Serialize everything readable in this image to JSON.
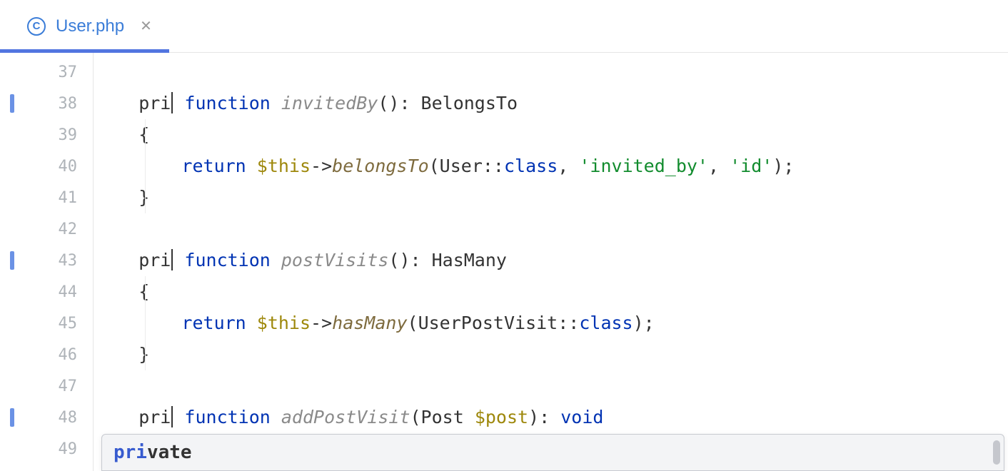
{
  "tab": {
    "name": "User.php",
    "icon_letter": "C"
  },
  "gutter": {
    "lines": [
      {
        "num": "37",
        "modified": false
      },
      {
        "num": "38",
        "modified": true
      },
      {
        "num": "39",
        "modified": false
      },
      {
        "num": "40",
        "modified": false
      },
      {
        "num": "41",
        "modified": false
      },
      {
        "num": "42",
        "modified": false
      },
      {
        "num": "43",
        "modified": true
      },
      {
        "num": "44",
        "modified": false
      },
      {
        "num": "45",
        "modified": false
      },
      {
        "num": "46",
        "modified": false
      },
      {
        "num": "47",
        "modified": false
      },
      {
        "num": "48",
        "modified": true
      },
      {
        "num": "49",
        "modified": false
      }
    ]
  },
  "code": {
    "line38_pre": "    pri",
    "line38_kw": " function ",
    "line38_fn": "invitedBy",
    "line38_after": "(): BelongsTo",
    "line39": "    {",
    "line40_indent": "        ",
    "line40_return": "return ",
    "line40_this": "$this",
    "line40_arrow": "->",
    "line40_method": "belongsTo",
    "line40_open": "(User::",
    "line40_class": "class",
    "line40_comma": ", ",
    "line40_str1": "'invited_by'",
    "line40_comma2": ", ",
    "line40_str2": "'id'",
    "line40_close": ");",
    "line41": "    }",
    "line43_pre": "    pri",
    "line43_kw": " function ",
    "line43_fn": "postVisits",
    "line43_after": "(): HasMany",
    "line44": "    {",
    "line45_indent": "        ",
    "line45_return": "return ",
    "line45_this": "$this",
    "line45_arrow": "->",
    "line45_method": "hasMany",
    "line45_open": "(UserPostVisit::",
    "line45_class": "class",
    "line45_close": ");",
    "line46": "    }",
    "line48_pre": "    pri",
    "line48_kw": " function ",
    "line48_fn": "addPostVisit",
    "line48_open": "(Post ",
    "line48_var": "$post",
    "line48_close": "): ",
    "line48_void": "void"
  },
  "autocomplete": {
    "match": "pri",
    "rest": "vate"
  }
}
